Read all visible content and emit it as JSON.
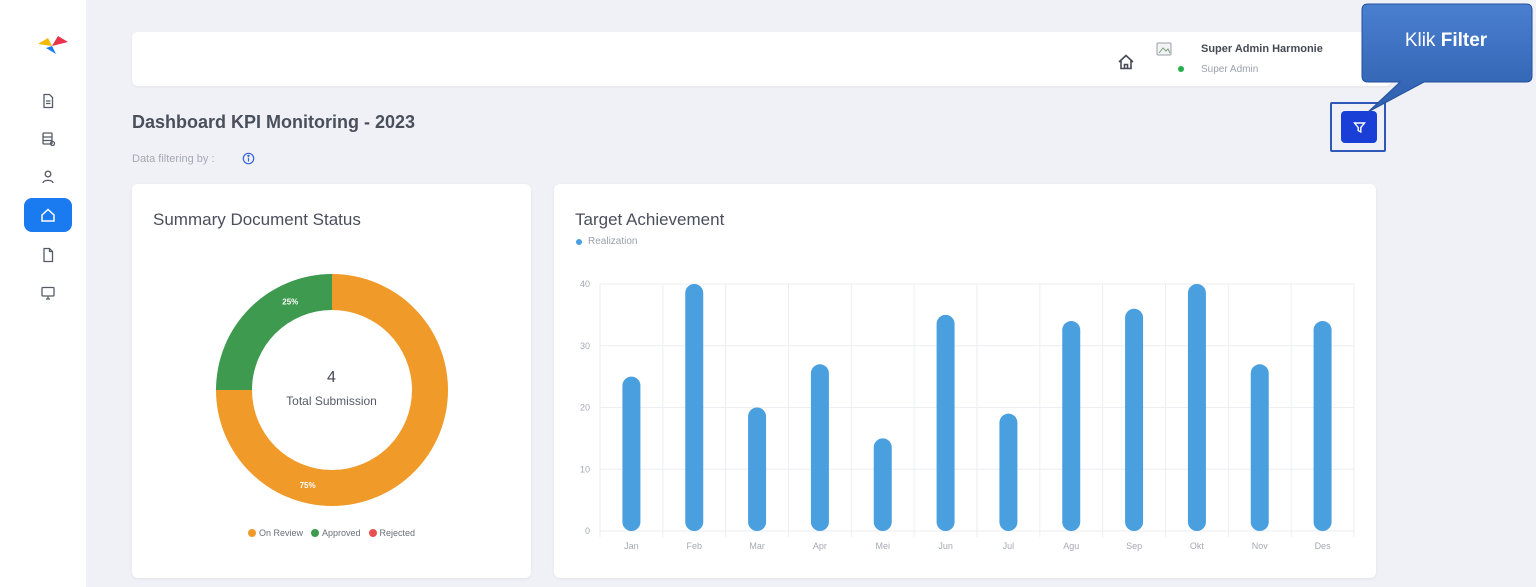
{
  "colors": {
    "accent": "#1a7af0",
    "filter_button": "#1a3fd6",
    "on_review": "#f09a2a",
    "approved": "#3d9a4f",
    "rejected": "#e85050",
    "bar": "#4a9fdf",
    "callout": "#3b6fc2"
  },
  "sidebar": {
    "logo_icon": "brand-logo-icon",
    "items": [
      {
        "icon": "document-icon",
        "active": false
      },
      {
        "icon": "database-icon",
        "active": false
      },
      {
        "icon": "user-icon",
        "active": false
      },
      {
        "icon": "home-icon",
        "active": true
      },
      {
        "icon": "file-icon",
        "active": false
      },
      {
        "icon": "monitor-icon",
        "active": false
      }
    ]
  },
  "topbar": {
    "user_name": "Super Admin Harmonie",
    "user_role": "Super Admin"
  },
  "page": {
    "title": "Dashboard KPI Monitoring - 2023",
    "filter_caption": "Data filtering by :"
  },
  "callout": {
    "prefix": "Klik",
    "bold": "Filter"
  },
  "doc_status": {
    "title": "Summary Document Status",
    "total": "4",
    "total_label": "Total Submission",
    "legend": {
      "on_review": "On Review",
      "approved": "Approved",
      "rejected": "Rejected"
    }
  },
  "target": {
    "title": "Target Achievement",
    "legend_label": "Realization"
  },
  "chart_data": [
    {
      "type": "pie",
      "title": "Summary Document Status",
      "categories": [
        "On Review",
        "Approved",
        "Rejected"
      ],
      "values": [
        75,
        25,
        0
      ],
      "labels": [
        "75%",
        "25%",
        ""
      ],
      "colors": [
        "#f09a2a",
        "#3d9a4f",
        "#e85050"
      ],
      "legend": "bottom"
    },
    {
      "type": "bar",
      "title": "Target Achievement",
      "categories": [
        "Jan",
        "Feb",
        "Mar",
        "Apr",
        "Mei",
        "Jun",
        "Jul",
        "Agu",
        "Sep",
        "Okt",
        "Nov",
        "Des"
      ],
      "series": [
        {
          "name": "Realization",
          "values": [
            25,
            40,
            20,
            27,
            15,
            35,
            19,
            34,
            36,
            40,
            27,
            34
          ]
        }
      ],
      "yticks": [
        0,
        10,
        20,
        30,
        40
      ],
      "ylim": [
        0,
        40
      ],
      "grid": true,
      "legend": "top-left"
    }
  ]
}
